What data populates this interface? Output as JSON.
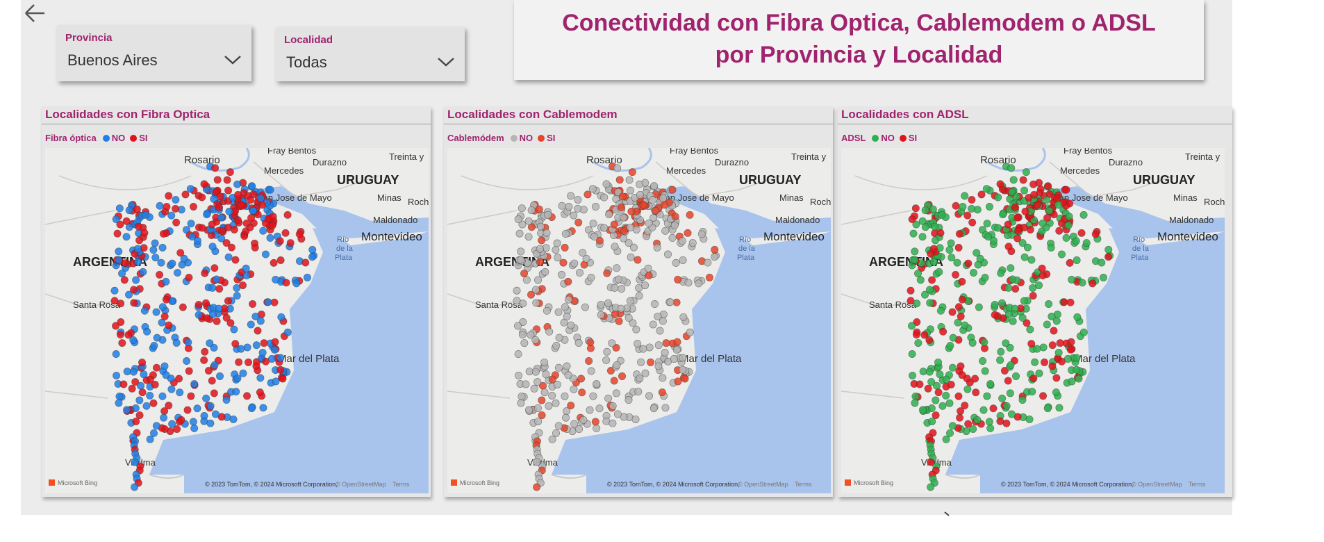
{
  "nav": {
    "back_icon": "arrow-left-icon"
  },
  "slicers": [
    {
      "label": "Provincia",
      "value": "Buenos Aires"
    },
    {
      "label": "Localidad",
      "value": "Todas"
    }
  ],
  "title": {
    "line1": "Conectividad con Fibra Optica, Cablemodem o ADSL",
    "line2": "por Provincia y Localidad"
  },
  "map_labels": {
    "rosario": "Rosario",
    "fray_bentos": "Fray Bentos",
    "durazno": "Durazno",
    "treinta": "Treinta y",
    "mercedes": "Mercedes",
    "uruguay": "URUGUAY",
    "san_jose": "San Jose de Mayo",
    "minas": "Minas",
    "roch": "Roch",
    "maldonado": "Maldonado",
    "montevideo": "Montevideo",
    "rio1": "Río",
    "rio2": "de la",
    "rio3": "Plata",
    "argentina": "ARGENTINA",
    "santa_rosa": "Santa Rosa",
    "mar_del_plata": "Mar del Plata",
    "viedma": "Viedma",
    "bing": "Microsoft Bing",
    "copyright": "© 2023 TomTom, © 2024 Microsoft Corporation,",
    "osm": "© OpenStreetMap",
    "terms": "Terms"
  },
  "panels": [
    {
      "title": "Localidades con Fibra Optica",
      "legend_title": "Fibra óptica",
      "no_label": "NO",
      "si_label": "SI",
      "no_color": "#1e7fe6",
      "si_color": "#e3121a"
    },
    {
      "title": "Localidades con Cablemodem",
      "legend_title": "Cablemódem",
      "no_label": "NO",
      "si_label": "SI",
      "no_color": "#b5b5b5",
      "si_color": "#e8442a"
    },
    {
      "title": "Localidades con ADSL",
      "legend_title": "ADSL",
      "no_label": "NO",
      "si_label": "SI",
      "no_color": "#2eb04f",
      "si_color": "#e3121a"
    }
  ]
}
